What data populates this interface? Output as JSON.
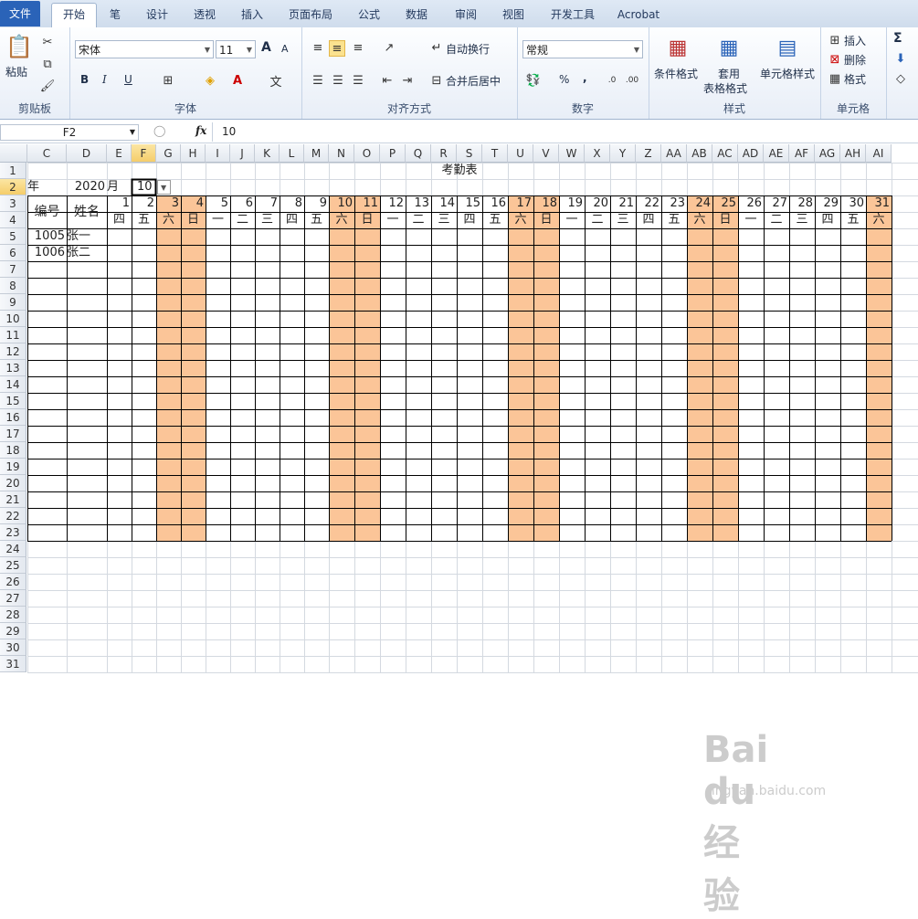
{
  "tabs": [
    "文件",
    "开始",
    "笔",
    "设计",
    "透视",
    "插入",
    "页面布局",
    "公式",
    "数据",
    "审阅",
    "视图",
    "开发工具",
    "Acrobat"
  ],
  "ribbon": {
    "clipboard": {
      "label": "剪贴板",
      "paste": "粘贴"
    },
    "font": {
      "label": "字体",
      "family": "宋体",
      "size": "11",
      "bold": "B",
      "italic": "I",
      "underline": "U",
      "grow": "A",
      "shrink": "A"
    },
    "align": {
      "label": "对齐方式",
      "wrap": "自动换行",
      "merge": "合并后居中"
    },
    "number": {
      "label": "数字",
      "format": "常规",
      "percent": "%",
      "comma": ","
    },
    "styles": {
      "label": "样式",
      "conditional": "条件格式",
      "table1": "套用",
      "table2": "表格格式",
      "cell": "单元格样式"
    },
    "cells": {
      "label": "单元格",
      "insert": "插入",
      "delete": "删除",
      "format": "格式"
    },
    "editing": {
      "sigma": "Σ"
    }
  },
  "formula": {
    "name": "F2",
    "fx": "fx",
    "value": "10"
  },
  "columns": [
    "C",
    "D",
    "E",
    "F",
    "G",
    "H",
    "I",
    "J",
    "K",
    "L",
    "M",
    "N",
    "O",
    "P",
    "Q",
    "R",
    "S",
    "T",
    "U",
    "V",
    "W",
    "X",
    "Y",
    "Z",
    "AA",
    "AB",
    "AC",
    "AD",
    "AE",
    "AF",
    "AG",
    "AH",
    "AI"
  ],
  "rows": [
    "1",
    "2",
    "3",
    "4",
    "5",
    "6",
    "7",
    "8",
    "9",
    "10",
    "11",
    "12",
    "13",
    "14",
    "15",
    "16",
    "17",
    "18",
    "19",
    "20",
    "21",
    "22",
    "23",
    "24",
    "25",
    "26",
    "27",
    "28",
    "29",
    "30",
    "31"
  ],
  "sheet": {
    "title": "考勤表",
    "year_label": "年",
    "year": "2020",
    "month_label": "月",
    "month": "10",
    "hdr_id": "编号",
    "hdr_name": "姓名",
    "days": [
      "1",
      "2",
      "3",
      "4",
      "5",
      "6",
      "7",
      "8",
      "9",
      "10",
      "11",
      "12",
      "13",
      "14",
      "15",
      "16",
      "17",
      "18",
      "19",
      "20",
      "21",
      "22",
      "23",
      "24",
      "25",
      "26",
      "27",
      "28",
      "29",
      "30",
      "31"
    ],
    "weekdays": [
      "四",
      "五",
      "六",
      "日",
      "一",
      "二",
      "三",
      "四",
      "五",
      "六",
      "日",
      "一",
      "二",
      "三",
      "四",
      "五",
      "六",
      "日",
      "一",
      "二",
      "三",
      "四",
      "五",
      "六",
      "日",
      "一",
      "二",
      "三",
      "四",
      "五",
      "六"
    ],
    "weekend_idx": [
      2,
      3,
      9,
      10,
      16,
      17,
      23,
      24,
      30
    ],
    "employees": [
      {
        "id": "1005",
        "name": "张一"
      },
      {
        "id": "1006",
        "name": "张二"
      }
    ]
  },
  "watermark": {
    "brand": "Bai du 经验",
    "url": "jingyan.baidu.com"
  }
}
